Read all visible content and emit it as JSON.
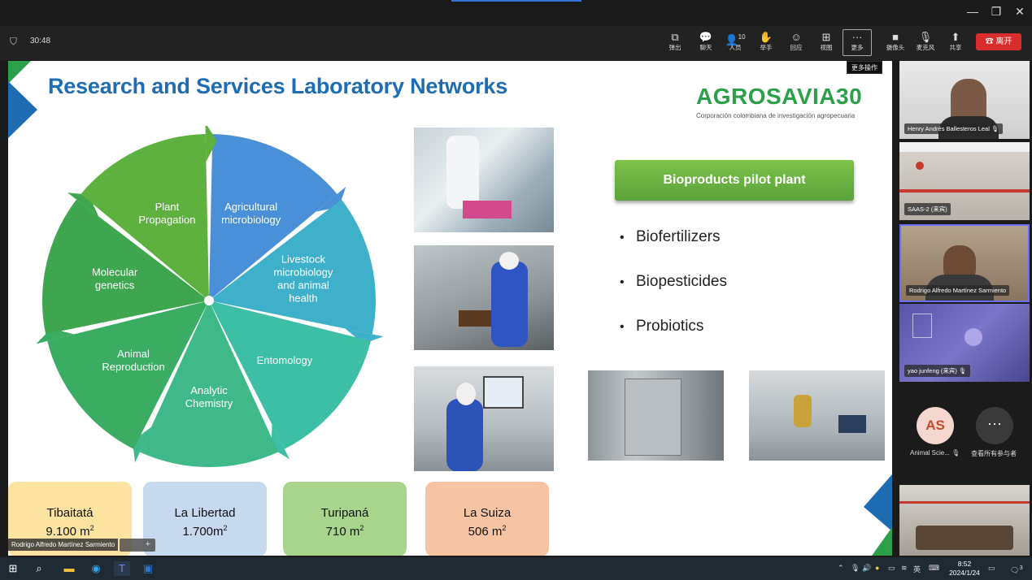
{
  "window": {
    "minimize": "—",
    "restore": "❐",
    "close": "✕"
  },
  "toolbar": {
    "timer": "30:48",
    "buttons": [
      {
        "key": "popout",
        "icon": "⧉",
        "label": "弹出"
      },
      {
        "key": "chat",
        "icon": "💬",
        "label": "聊天"
      },
      {
        "key": "people",
        "icon": "👤",
        "label": "人员",
        "count": "10"
      },
      {
        "key": "raise-hand",
        "icon": "✋",
        "label": "举手"
      },
      {
        "key": "react",
        "icon": "☺",
        "label": "回应"
      },
      {
        "key": "view",
        "icon": "⊞",
        "label": "视图"
      },
      {
        "key": "more",
        "icon": "···",
        "label": "更多"
      },
      {
        "key": "camera",
        "icon": "■",
        "label": "摄像头"
      },
      {
        "key": "mic",
        "icon": "🎙",
        "label": "麦克风"
      },
      {
        "key": "share",
        "icon": "⬆",
        "label": "共享"
      }
    ],
    "leave_label": "离开",
    "tooltip": "更多操作"
  },
  "slide": {
    "title": "Research and Services Laboratory Networks",
    "logo_text": "AGROSAVIA30",
    "logo_sub": "Corporación colombiana de investigación agropecuaria",
    "wheel": [
      {
        "lines": [
          "Agricultural",
          "microbiology"
        ],
        "color": "#4a90d9"
      },
      {
        "lines": [
          "Livestock",
          "microbiology",
          "and animal",
          "health"
        ],
        "color": "#3fb0c9"
      },
      {
        "lines": [
          "Entomology"
        ],
        "color": "#3dbfa6"
      },
      {
        "lines": [
          "Analytic",
          "Chemistry"
        ],
        "color": "#3fb98a"
      },
      {
        "lines": [
          "Animal",
          "Reproduction"
        ],
        "color": "#3aad62"
      },
      {
        "lines": [
          "Molecular",
          "genetics"
        ],
        "color": "#3ea64e"
      },
      {
        "lines": [
          "Plant",
          "Propagation"
        ],
        "color": "#5eb03f"
      }
    ],
    "pilot_label": "Bioproducts pilot plant",
    "bullets": [
      "Biofertilizers",
      "Biopesticides",
      "Probiotics"
    ],
    "sites": [
      {
        "name": "Tibaitatá",
        "area": "9.100 m",
        "color": "#fde3a0"
      },
      {
        "name": "La Libertad",
        "area": "1.700m",
        "color": "#c6d9ef"
      },
      {
        "name": "Turipaná",
        "area": "710 m",
        "color": "#a9d48b"
      },
      {
        "name": "La Suiza",
        "area": "506 m",
        "color": "#f7c4a3"
      }
    ],
    "area_unit_sup": "2"
  },
  "participants": [
    {
      "name": "Henry Andrés Ballesteros Leal",
      "mic": "🎙"
    },
    {
      "name": "SAAS-2 (来宾)",
      "mic": ""
    },
    {
      "name": "Rodrigo Alfredo Martínez Sarmiento",
      "mic": ""
    },
    {
      "name": "yao junfeng (来宾)",
      "mic": "🎙"
    }
  ],
  "avatar": {
    "initials": "AS",
    "label": "Animal Scie..."
  },
  "see_all": {
    "icon": "···",
    "label": "查看所有参与者"
  },
  "speaker_tag": "Rodrigo Alfredo Martínez Sarmiento",
  "expand_icon": "+",
  "taskbar": {
    "time": "8:52",
    "date": "2024/1/24",
    "ime": "英",
    "notification_count": "3"
  }
}
